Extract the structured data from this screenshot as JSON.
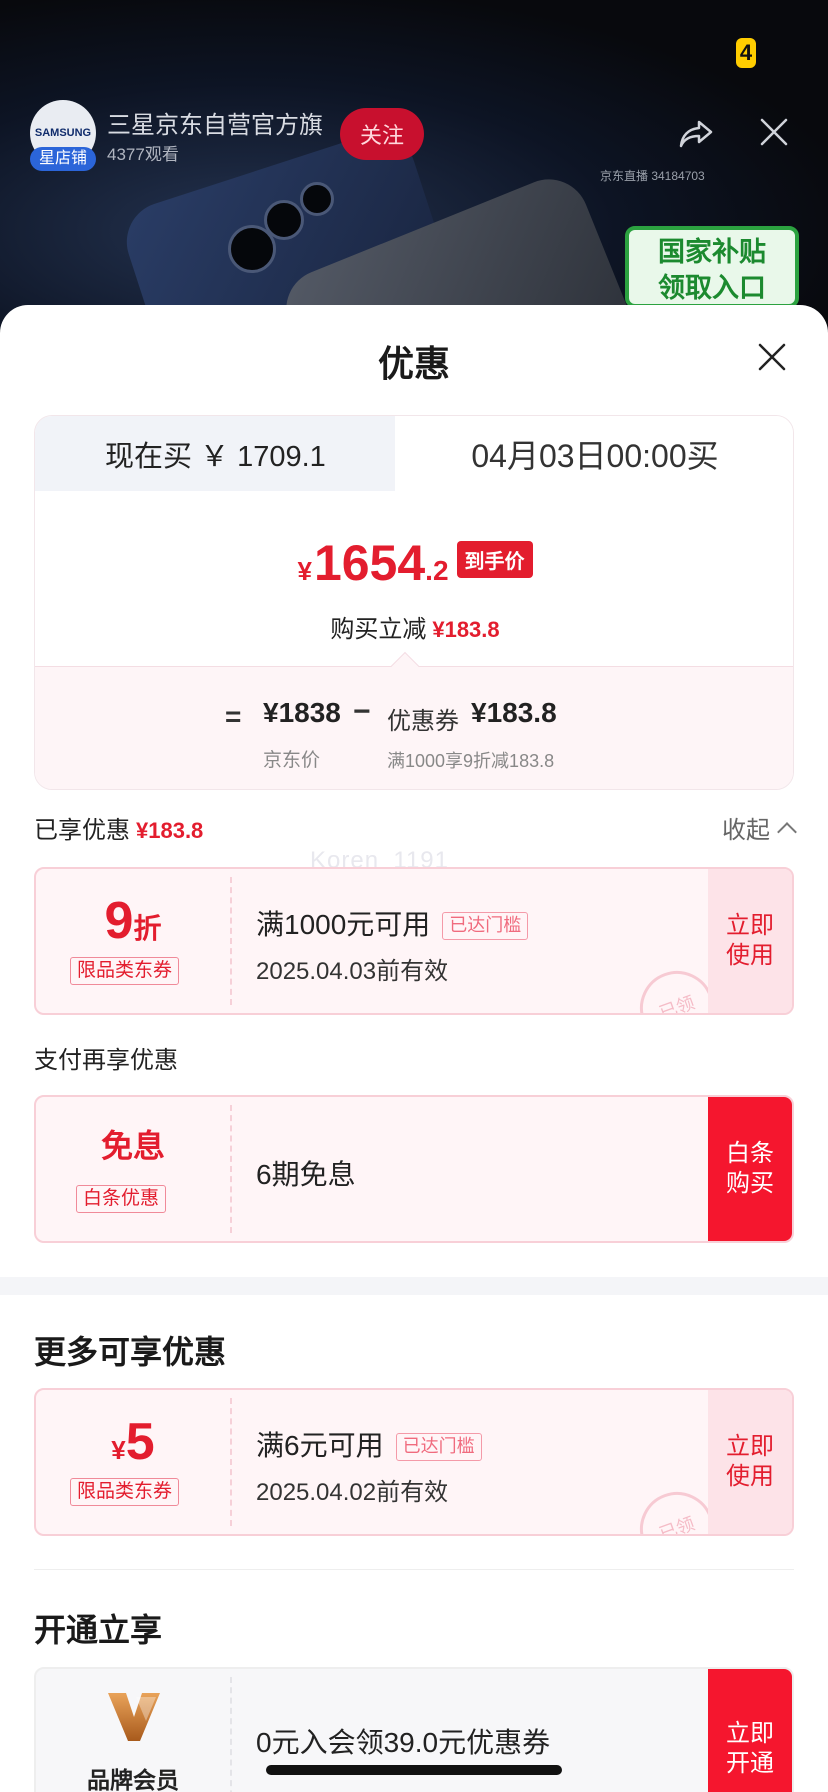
{
  "live": {
    "badge": "4",
    "shop_avatar_text": "SAMSUNG",
    "shop_tag": "星店铺",
    "shop_name": "三星京东自营官方旗",
    "viewers": "4377观看",
    "follow_label": "关注",
    "room_id": "京东直播 34184703",
    "subsidy_line1": "国家补贴",
    "subsidy_line2": "领取入口"
  },
  "sheet": {
    "title": "优惠",
    "tab_now": "现在买 ￥ 1709.1",
    "tab_later": "04月03日00:00买",
    "final_symbol": "¥",
    "final_int": "1654",
    "final_dec": ".2",
    "final_tag": "到手价",
    "cut_label": "购买立减",
    "cut_value": "¥183.8",
    "eq": "=",
    "jd_price": "¥1838",
    "minus": "−",
    "coupon_label": "优惠券",
    "coupon_value": "¥183.8",
    "jd_price_label": "京东价",
    "coupon_rule": "满1000享9折减183.8",
    "enjoyed_label": "已享优惠",
    "enjoyed_value": "¥183.8",
    "collapse_label": "收起",
    "watermark": "Koren_1191"
  },
  "coupon1": {
    "value": "9",
    "unit": "折",
    "tag": "限品类东券",
    "title": "满1000元可用",
    "badge": "已达门槛",
    "date": "2025.04.03前有效",
    "action": "立即使用",
    "stamp": "已领"
  },
  "pay": {
    "label": "支付再享优惠",
    "value": "免息",
    "tag": "白条优惠",
    "title": "6期免息",
    "action": "白条购买"
  },
  "more": {
    "title": "更多可享优惠"
  },
  "coupon2": {
    "symbol": "¥",
    "value": "5",
    "tag": "限品类东券",
    "title": "满6元可用",
    "badge": "已达门槛",
    "date": "2025.04.02前有效",
    "action": "立即使用",
    "stamp": "已领"
  },
  "member": {
    "section_title": "开通立享",
    "logo_icon": "v-brand-logo",
    "label": "品牌会员",
    "text": "0元入会领39.0元优惠券",
    "action": "立即开通"
  },
  "colors": {
    "accent_red": "#e31d2e",
    "action_red": "#f5162e",
    "subsidy_green": "#2ca240"
  }
}
